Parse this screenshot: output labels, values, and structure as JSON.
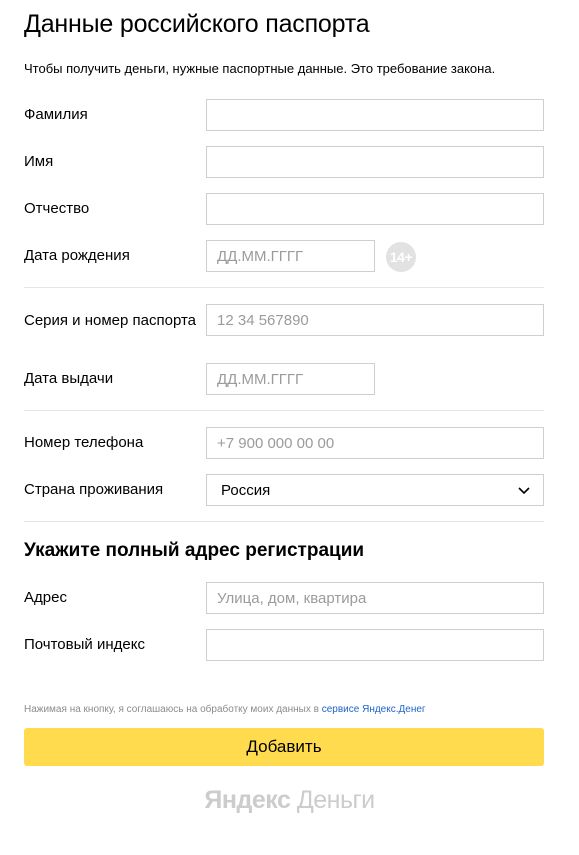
{
  "page": {
    "title": "Данные российского паспорта",
    "intro": "Чтобы получить деньги, нужные паспортные данные. Это требование закона."
  },
  "fields": {
    "surname": {
      "label": "Фамилия",
      "value": ""
    },
    "name": {
      "label": "Имя",
      "value": ""
    },
    "patronymic": {
      "label": "Отчество",
      "value": ""
    },
    "birth_date": {
      "label": "Дата рождения",
      "placeholder": "ДД.ММ.ГГГГ",
      "badge": "14+"
    },
    "passport_number": {
      "label": "Серия и номер паспорта",
      "placeholder": "12 34 567890"
    },
    "issue_date": {
      "label": "Дата выдачи",
      "placeholder": "ДД.ММ.ГГГГ"
    },
    "phone": {
      "label": "Номер телефона",
      "placeholder": "+7 900 000 00 00"
    },
    "country": {
      "label": "Страна проживания",
      "selected": "Россия"
    }
  },
  "address_section": {
    "title": "Укажите полный адрес регистрации",
    "address": {
      "label": "Адрес",
      "placeholder": "Улица, дом, квартира"
    },
    "postal_code": {
      "label": "Почтовый индекс",
      "value": ""
    }
  },
  "consent": {
    "text": "Нажимая на кнопку, я соглашаюсь на обработку моих данных в",
    "link": "сервисе Яндекс.Денег"
  },
  "submit_label": "Добавить",
  "footer": {
    "brand": "Яндекс",
    "product": "Деньги"
  },
  "icons": {
    "dropdown": "chevron-down-icon"
  },
  "colors": {
    "button_bg": "#ffdb4d",
    "link": "#1e64c8",
    "badge_bg": "#e2e2e2",
    "logo": "#cccccc"
  }
}
